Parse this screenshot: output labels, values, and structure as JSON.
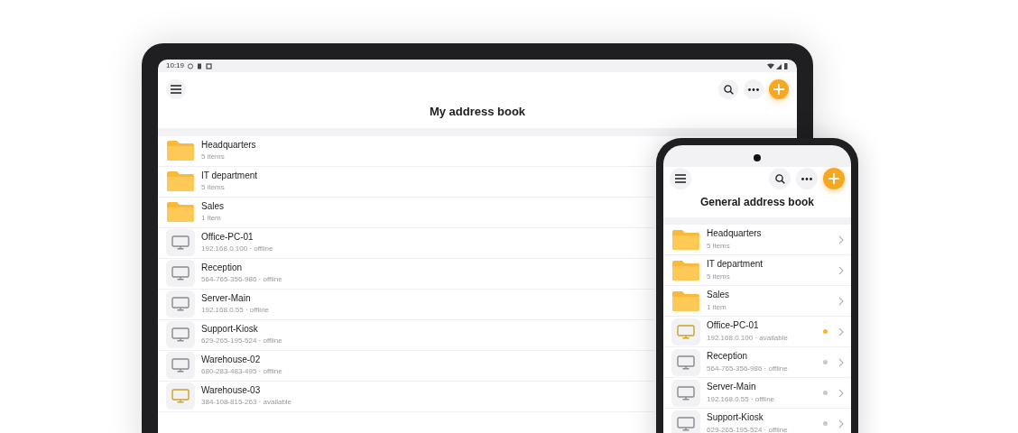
{
  "tablet": {
    "status_bar": {
      "time": "10:19"
    },
    "title": "My address book",
    "items": [
      {
        "kind": "folder",
        "name": "Headquarters",
        "detail": "5 items"
      },
      {
        "kind": "folder",
        "name": "IT department",
        "detail": "5 items"
      },
      {
        "kind": "folder",
        "name": "Sales",
        "detail": "1 item"
      },
      {
        "kind": "device",
        "name": "Office-PC-01",
        "detail": "192.168.0.100 · offline",
        "available": false
      },
      {
        "kind": "device",
        "name": "Reception",
        "detail": "564-765-356-986 · offline",
        "available": false
      },
      {
        "kind": "device",
        "name": "Server-Main",
        "detail": "192.168.0.55 · offline",
        "available": false
      },
      {
        "kind": "device",
        "name": "Support-Kiosk",
        "detail": "629-265-195-524 · offline",
        "available": false
      },
      {
        "kind": "device",
        "name": "Warehouse-02",
        "detail": "680-283-483-495 · offline",
        "available": false
      },
      {
        "kind": "device",
        "name": "Warehouse-03",
        "detail": "384-108-815-263 · available",
        "available": true
      }
    ]
  },
  "phone": {
    "title": "General address book",
    "items": [
      {
        "kind": "folder",
        "name": "Headquarters",
        "detail": "5 items"
      },
      {
        "kind": "folder",
        "name": "IT department",
        "detail": "5 items"
      },
      {
        "kind": "folder",
        "name": "Sales",
        "detail": "1 item"
      },
      {
        "kind": "device",
        "name": "Office-PC-01",
        "detail": "192.168.0.100 · available",
        "available": true
      },
      {
        "kind": "device",
        "name": "Reception",
        "detail": "564-765-356-986 · offline",
        "available": false
      },
      {
        "kind": "device",
        "name": "Server-Main",
        "detail": "192.168.0.55 · offline",
        "available": false
      },
      {
        "kind": "device",
        "name": "Support-Kiosk",
        "detail": "629-265-195-524 · offline",
        "available": false
      }
    ]
  }
}
